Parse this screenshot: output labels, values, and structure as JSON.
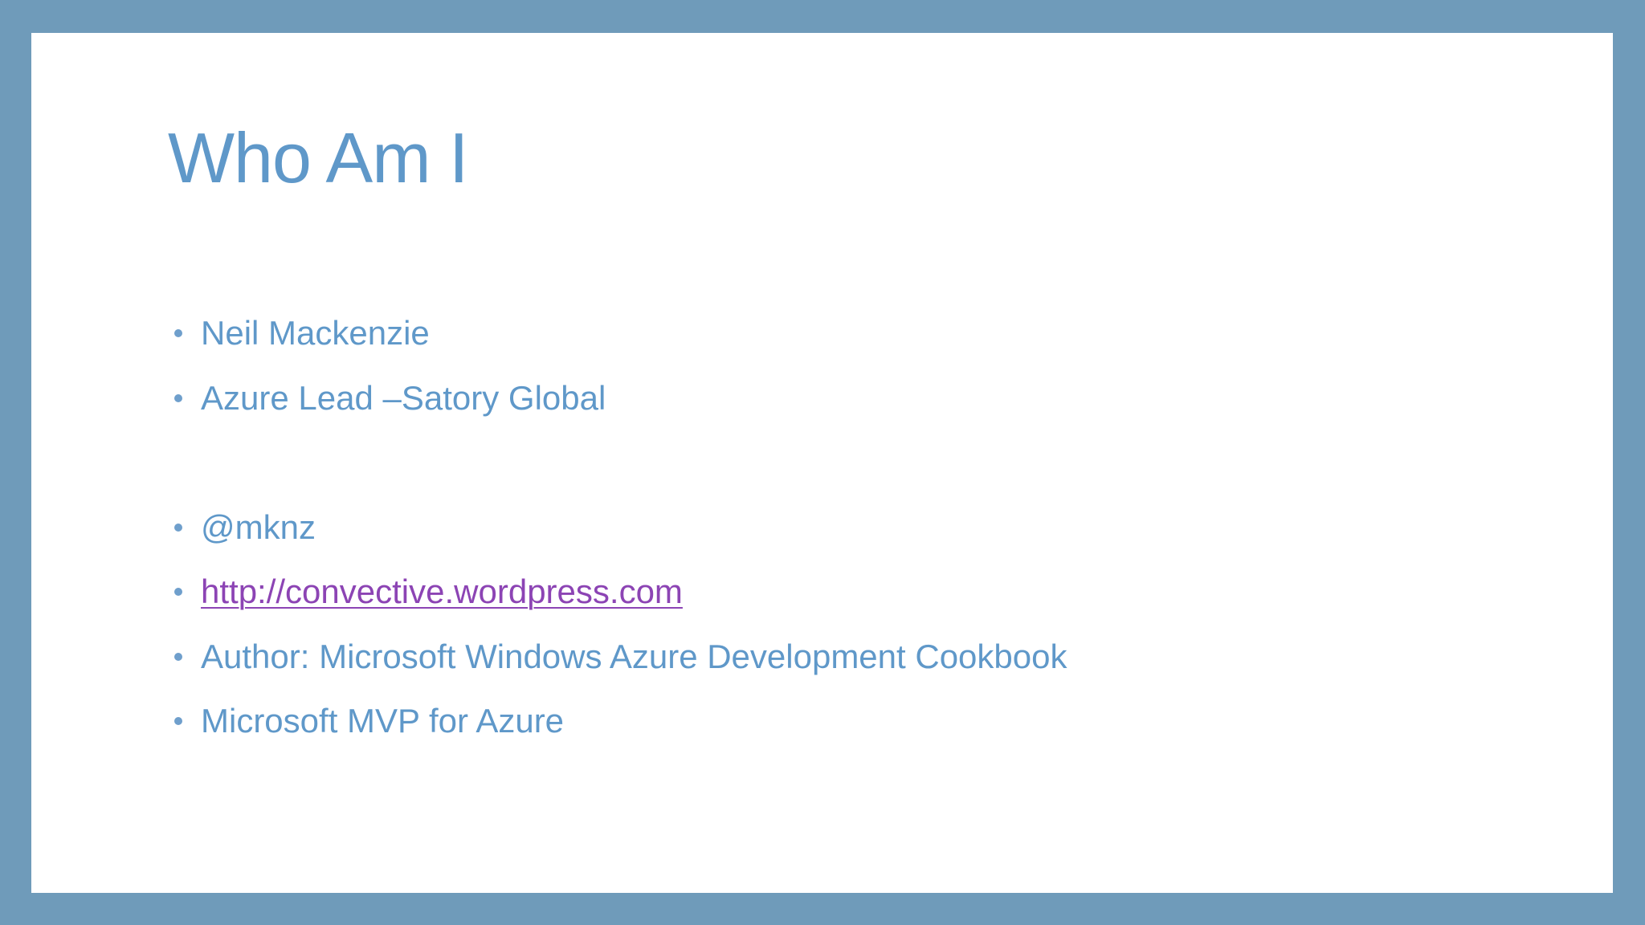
{
  "slide": {
    "title": "Who Am I",
    "bullets": [
      "Neil Mackenzie",
      "Azure Lead –Satory Global",
      "@mknz",
      "http://convective.wordpress.com",
      "Author: Microsoft Windows Azure Development Cookbook",
      "Microsoft MVP for Azure"
    ]
  },
  "colors": {
    "frame": "#6f9bba",
    "background": "#ffffff",
    "text": "#5f98c9",
    "link": "#8c44b4"
  }
}
